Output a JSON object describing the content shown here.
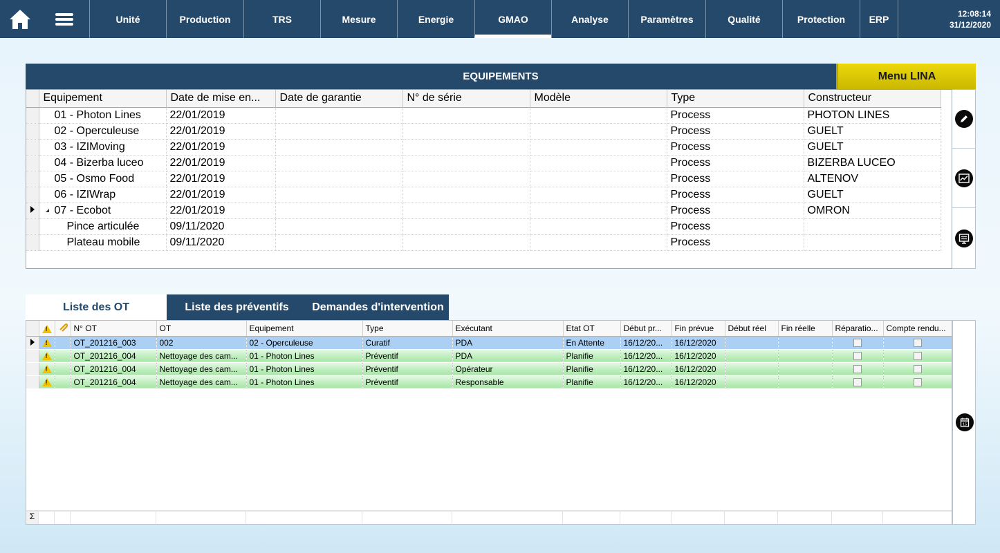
{
  "nav": {
    "items": [
      "Unité",
      "Production",
      "TRS",
      "Mesure",
      "Energie",
      "GMAO",
      "Analyse",
      "Paramètres",
      "Qualité",
      "Protection",
      "ERP"
    ],
    "active": "GMAO",
    "time": "12:08:14",
    "date": "31/12/2020"
  },
  "equipements": {
    "title": "EQUIPEMENTS",
    "menu_button": "Menu LINA",
    "columns": [
      "Equipement",
      "Date de mise en...",
      "Date de garantie",
      "N° de série",
      "Modèle",
      "Type",
      "Constructeur"
    ],
    "rows": [
      {
        "equipement": "01 - Photon Lines",
        "date_mise": "22/01/2019",
        "date_garantie": "",
        "serie": "",
        "modele": "",
        "type": "Process",
        "constructeur": "PHOTON LINES"
      },
      {
        "equipement": "02 - Operculeuse",
        "date_mise": "22/01/2019",
        "date_garantie": "",
        "serie": "",
        "modele": "",
        "type": "Process",
        "constructeur": "GUELT"
      },
      {
        "equipement": "03 - IZIMoving",
        "date_mise": "22/01/2019",
        "date_garantie": "",
        "serie": "",
        "modele": "",
        "type": "Process",
        "constructeur": "GUELT"
      },
      {
        "equipement": "04 - Bizerba luceo",
        "date_mise": "22/01/2019",
        "date_garantie": "",
        "serie": "",
        "modele": "",
        "type": "Process",
        "constructeur": "BIZERBA LUCEO"
      },
      {
        "equipement": "05 - Osmo Food",
        "date_mise": "22/01/2019",
        "date_garantie": "",
        "serie": "",
        "modele": "",
        "type": "Process",
        "constructeur": "ALTENOV"
      },
      {
        "equipement": "06 - IZIWrap",
        "date_mise": "22/01/2019",
        "date_garantie": "",
        "serie": "",
        "modele": "",
        "type": "Process",
        "constructeur": "GUELT"
      },
      {
        "equipement": "07 - Ecobot",
        "date_mise": "22/01/2019",
        "date_garantie": "",
        "serie": "",
        "modele": "",
        "type": "Process",
        "constructeur": "OMRON"
      },
      {
        "equipement": "Pince articulée",
        "date_mise": "09/11/2020",
        "date_garantie": "",
        "serie": "",
        "modele": "",
        "type": "Process",
        "constructeur": ""
      },
      {
        "equipement": "Plateau mobile",
        "date_mise": "09/11/2020",
        "date_garantie": "",
        "serie": "",
        "modele": "",
        "type": "Process",
        "constructeur": ""
      }
    ]
  },
  "tabs": [
    "Liste des OT",
    "Liste des préventifs",
    "Demandes d'intervention"
  ],
  "ot": {
    "columns": [
      "N° OT",
      "OT",
      "Equipement",
      "Type",
      "Exécutant",
      "Etat OT",
      "Début pr...",
      "Fin prévue",
      "Début réel",
      "Fin réelle",
      "Réparatio...",
      "Compte rendu..."
    ],
    "rows": [
      {
        "num": "OT_201216_003",
        "ot": "002",
        "equipement": "02 - Operculeuse",
        "type": "Curatif",
        "executant": "PDA",
        "etat": "En Attente",
        "debut_prevu": "16/12/20...",
        "fin_prevue": "16/12/2020",
        "debut_reel": "",
        "fin_reelle": ""
      },
      {
        "num": "OT_201216_004",
        "ot": "Nettoyage des cam...",
        "equipement": "01 - Photon Lines",
        "type": "Préventif",
        "executant": "PDA",
        "etat": "Planifie",
        "debut_prevu": "16/12/20...",
        "fin_prevue": "16/12/2020",
        "debut_reel": "",
        "fin_reelle": ""
      },
      {
        "num": "OT_201216_004",
        "ot": "Nettoyage des cam...",
        "equipement": "01 - Photon Lines",
        "type": "Préventif",
        "executant": "Opérateur",
        "etat": "Planifie",
        "debut_prevu": "16/12/20...",
        "fin_prevue": "16/12/2020",
        "debut_reel": "",
        "fin_reelle": ""
      },
      {
        "num": "OT_201216_004",
        "ot": "Nettoyage des cam...",
        "equipement": "01 - Photon Lines",
        "type": "Préventif",
        "executant": "Responsable",
        "etat": "Planifie",
        "debut_prevu": "16/12/20...",
        "fin_prevue": "16/12/2020",
        "debut_reel": "",
        "fin_reelle": ""
      }
    ],
    "sum_symbol": "Σ"
  }
}
